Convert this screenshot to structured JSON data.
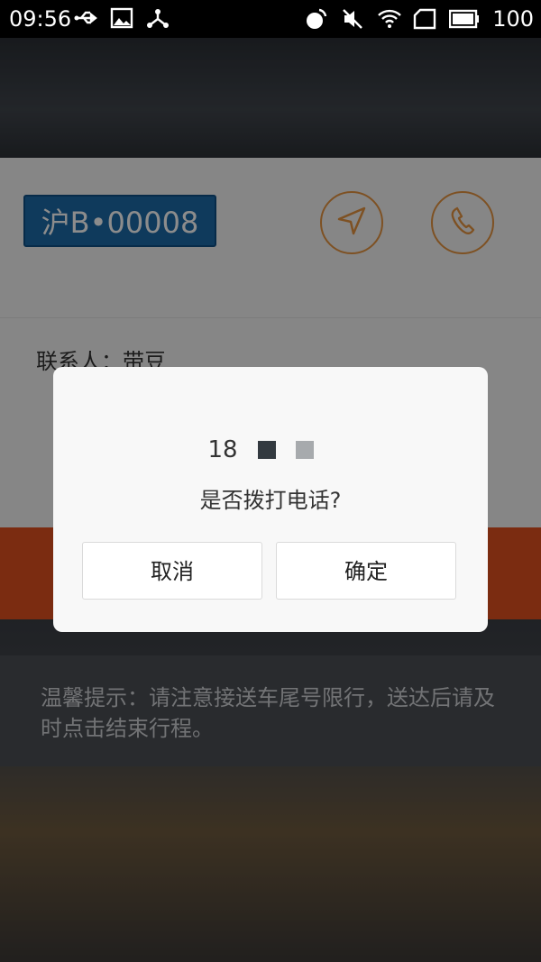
{
  "status_bar": {
    "time": "09:56",
    "battery": "100",
    "left_icons": [
      "usb-icon",
      "image-icon",
      "share-icon"
    ],
    "right_icons": [
      "call-icon",
      "mute-icon",
      "wifi-icon",
      "signal-icon",
      "battery-icon"
    ]
  },
  "trip": {
    "plate": "沪B•00008",
    "contact": "联系人：带豆",
    "destination": "",
    "action_label": "",
    "navigate_icon": "navigation-arrow-icon",
    "call_icon": "phone-icon"
  },
  "notice": {
    "text": "温馨提示：请注意接送车尾号限行，送达后请及时点击结束行程。"
  },
  "dialog": {
    "phone_prefix": "18",
    "masked_colors": [
      "#333a40",
      "#a7aaad"
    ],
    "question": "是否拨打电话?",
    "cancel_label": "取消",
    "confirm_label": "确定"
  },
  "colors": {
    "plate_blue": "#1d6aa8",
    "accent_orange": "#e69440",
    "action_red": "#e0501f"
  }
}
